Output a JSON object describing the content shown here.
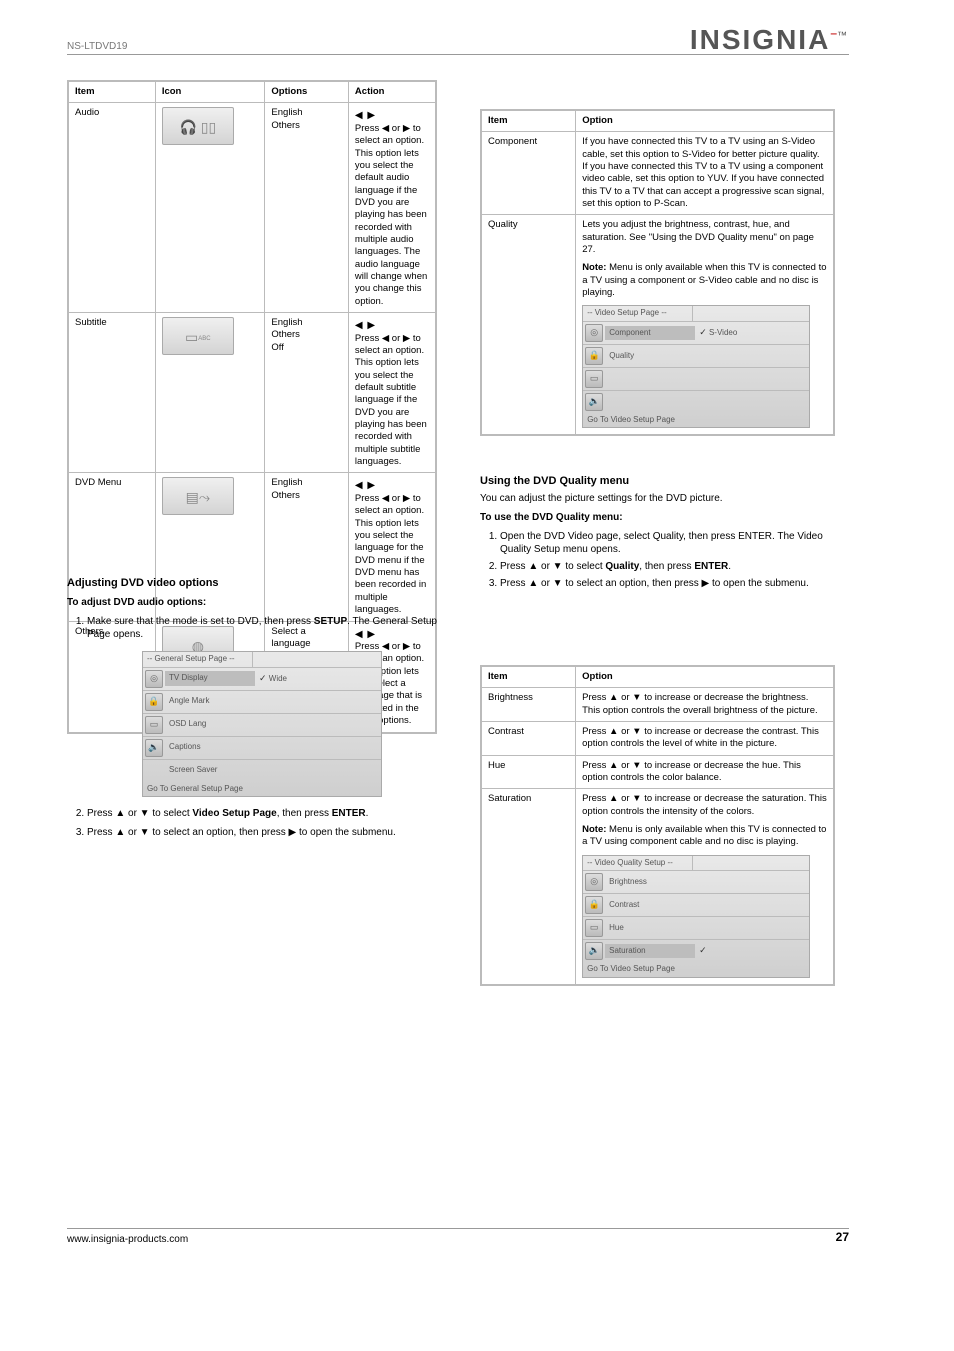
{
  "logo": {
    "text": "INSIGNIA",
    "tm": "™"
  },
  "footer": {
    "left": "www.insignia-products.com",
    "page": "27"
  },
  "tbl1": {
    "headers": [
      "Item",
      "Icon",
      "Options",
      "Action"
    ],
    "rows": [
      {
        "item": "Audio",
        "optA": "English",
        "optB": "Others",
        "actHead": "Press ◀ or ▶ to select an option.",
        "actCont": "This option lets you select the default audio language if the DVD you are playing has been recorded with multiple audio languages. The audio language will change when you change this option."
      },
      {
        "item": "Subtitle",
        "optA": "English",
        "optB": "Others",
        "optC": "Off",
        "actHead": "Press ◀ or ▶ to select an option.",
        "actCont": "This option lets you select the default subtitle language if the DVD you are playing has been recorded with multiple subtitle languages."
      },
      {
        "item": "DVD Menu",
        "optA": "English",
        "optB": "Others",
        "actHead": "Press ◀ or ▶ to select an option.",
        "actCont": "This option lets you select the language for the DVD menu if the DVD menu has been recorded in multiple languages."
      },
      {
        "item": "Others",
        "opt": "Select a language",
        "actHead": "Press ◀ or ▶ to select an option.",
        "actCont": "This option lets you select a language that is not listed in the main options."
      }
    ]
  },
  "left_bottom": {
    "heading": "Adjusting DVD video options",
    "lead": "To adjust DVD audio options:",
    "steps": {
      "s1a": "Make sure that the mode is set to DVD, then press",
      "s1b": "SETUP",
      "s1c": ". The General Setup Page opens.",
      "miniTitle": "-- General Setup Page --",
      "rowsLabels": [
        "TV Display",
        "Angle Mark",
        "OSD Lang",
        "Captions",
        "Screen Saver"
      ],
      "rowValTop": "Wide",
      "miniCaption": "Go To General Setup Page",
      "s2a": "Press ▲ or ▼ to select",
      "s2b": "Video Setup Page",
      "s2c": ", then press ",
      "s2d": "ENTER",
      "s2e": ".",
      "s3a": "Press ▲ or ▼ to select an option, then press ▶ to open the submenu."
    }
  },
  "tbl2": {
    "headers": [
      "Item",
      "Option"
    ],
    "itemA": "Component",
    "descA": "If you have connected this TV to a TV using an S-Video cable, set this option to S-Video for better picture quality. If you have connected this TV to a TV using a component video cable, set this option to YUV. If you have connected this TV to a TV that can accept a progressive scan signal, set this option to P-Scan.",
    "itemB": "Quality",
    "descB": "Lets you adjust the brightness, contrast, hue, and saturation. See \"Using the DVD Quality menu\" on page 27.",
    "noteHead": "Note:",
    "note": "Menu is only available when this TV is connected to a TV using a component or S-Video cable and no disc is playing.",
    "mini": {
      "title": "-- Video Setup Page --",
      "row1": "Component",
      "row1val": "S-Video",
      "row2": "Quality",
      "cap": "Go To Video Setup Page"
    }
  },
  "tbl3": {
    "headers": [
      "Item",
      "Option"
    ],
    "itemA": "Brightness",
    "descA": "Press ▲ or ▼ to increase or decrease the brightness. This option controls the overall brightness of the picture.",
    "itemB": "Contrast",
    "descB": "Press ▲ or ▼ to increase or decrease the contrast. This option controls the level of white in the picture.",
    "itemC": "Hue",
    "descC": "Press ▲ or ▼ to increase or decrease the hue. This option controls the color balance.",
    "itemD": "Saturation",
    "descD": "Press ▲ or ▼ to increase or decrease the saturation. This option controls the intensity of the colors.",
    "noteHead": "Note:",
    "note": "Menu is only available when this TV is connected to a TV using component cable and no disc is playing.",
    "mini": {
      "title": "-- Video Quality Setup --",
      "rows": [
        "Brightness",
        "Contrast",
        "Hue",
        "Saturation"
      ],
      "cap": "Go To Video Setup Page"
    }
  },
  "left_extra": {
    "h1": "Using the DVD Quality menu",
    "p1": "You can adjust the picture settings for the DVD picture.",
    "h2": "To use the DVD Quality menu:",
    "s1": "Open the DVD Video page, select Quality, then press ENTER. The Video Quality Setup menu opens.",
    "s2a": "Press ▲ or ▼ to select",
    "s2b": "Quality",
    "s2c": ", then press",
    "s2d": "ENTER",
    "s2e": ".",
    "s3": "Press ▲ or ▼ to select an option, then press ▶ to open the submenu."
  },
  "header_small": "NS-LTDVD19"
}
